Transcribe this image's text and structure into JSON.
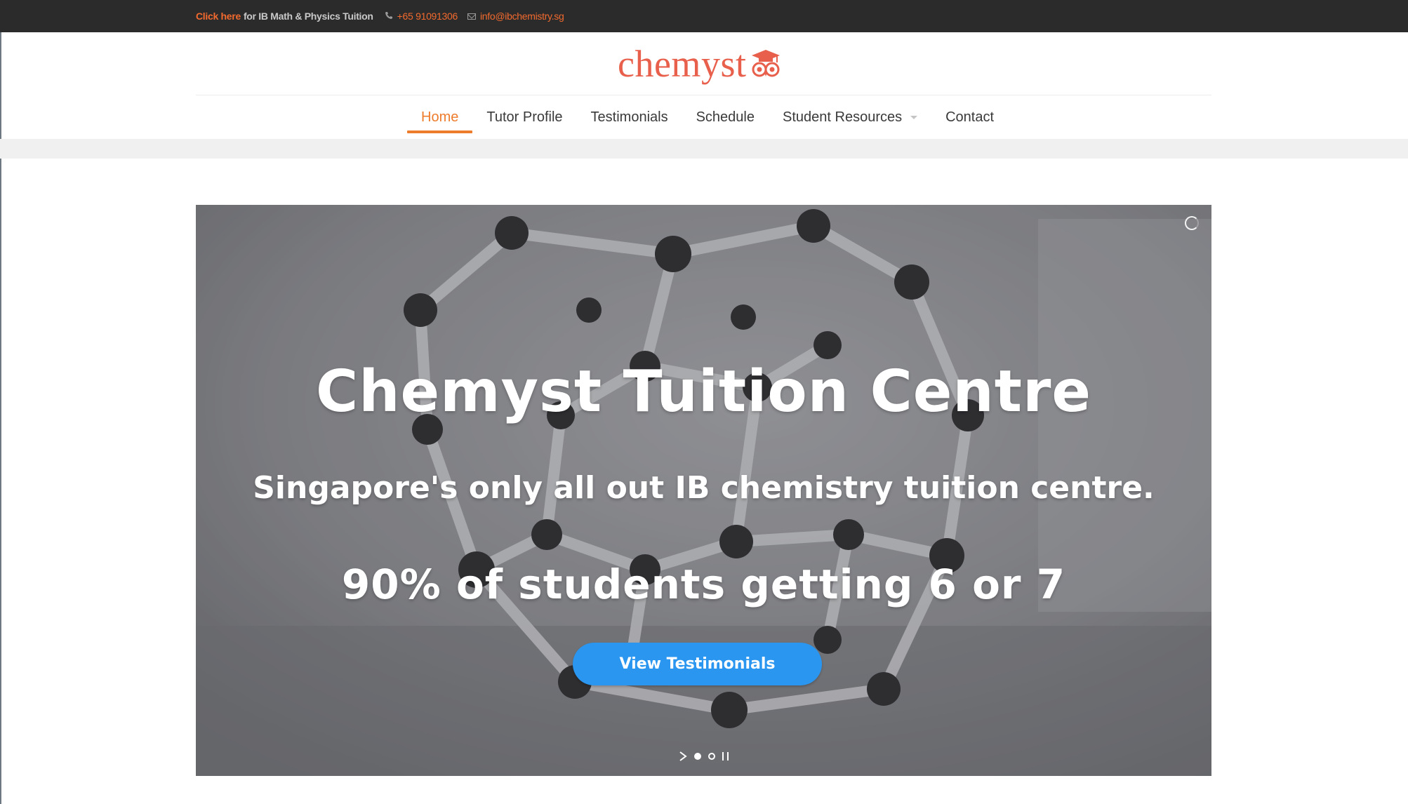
{
  "topbar": {
    "click_here": "Click here",
    "promo_text": "for IB Math & Physics Tuition",
    "phone": "+65 91091306",
    "email": "info@ibchemistry.sg",
    "phone_icon": "phone-icon",
    "email_icon": "envelope-icon"
  },
  "header": {
    "logo_text": "chemyst",
    "logo_icon": "owl-graduation-cap-icon",
    "brand_color": "#e8604c"
  },
  "nav": {
    "items": [
      {
        "label": "Home",
        "active": true
      },
      {
        "label": "Tutor Profile",
        "active": false
      },
      {
        "label": "Testimonials",
        "active": false
      },
      {
        "label": "Schedule",
        "active": false
      },
      {
        "label": "Student Resources",
        "active": false,
        "has_dropdown": true
      },
      {
        "label": "Contact",
        "active": false
      }
    ],
    "accent": "#ee7c2d"
  },
  "hero": {
    "title": "Chemyst Tuition Centre",
    "subtitle": "Singapore's only all out IB chemistry tuition centre.",
    "stat": "90% of students getting 6 or 7",
    "button_label": "View Testimonials",
    "button_color": "#2a96f0",
    "slides_count": 2,
    "active_slide": 1,
    "background": "molecular model (buckyball) photo"
  }
}
